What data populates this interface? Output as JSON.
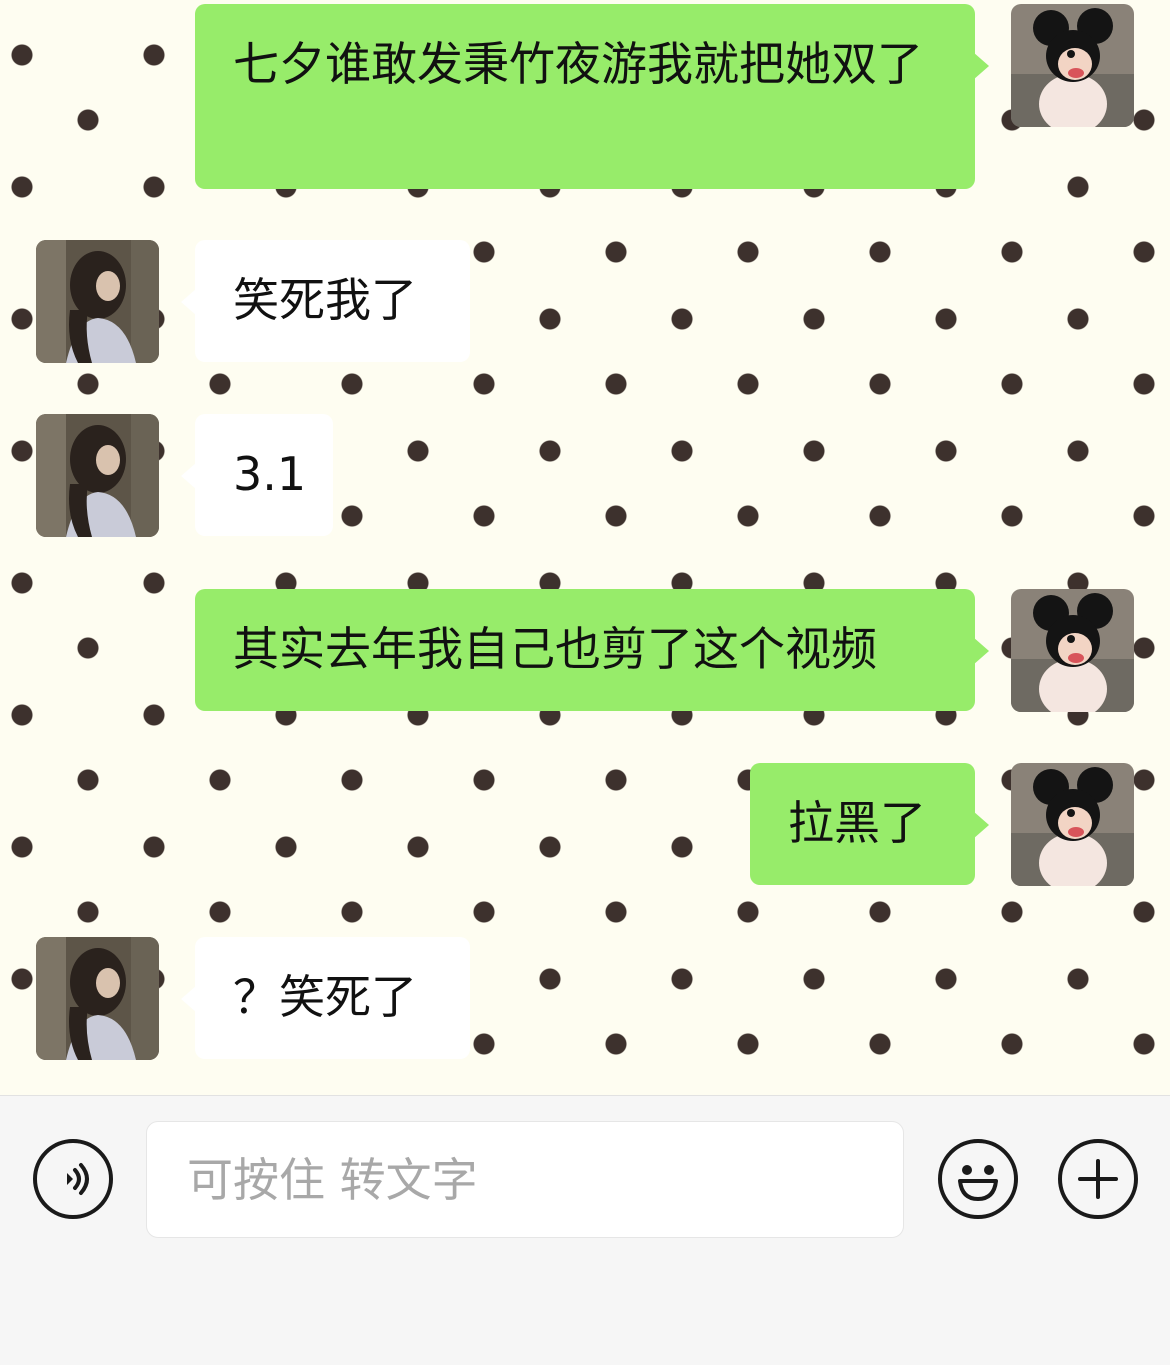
{
  "messages": [
    {
      "sender": "me",
      "text": "七夕谁敢发秉竹夜游我就把她双了"
    },
    {
      "sender": "other",
      "text": "笑死我了"
    },
    {
      "sender": "other",
      "text": "3.1"
    },
    {
      "sender": "me",
      "text": "其实去年我自己也剪了这个视频"
    },
    {
      "sender": "me",
      "text": "拉黑了"
    },
    {
      "sender": "other",
      "text": "？笑死了"
    }
  ],
  "avatars": {
    "me": "mickey-mask-avatar",
    "other": "long-hair-girl-avatar"
  },
  "input_bar": {
    "placeholder": "可按住 转文字",
    "voice_icon": "voice-icon",
    "emoji_icon": "emoji-icon",
    "plus_icon": "plus-icon"
  },
  "colors": {
    "my_bubble": "#97ec6a",
    "other_bubble": "#ffffff",
    "chat_background": "#fefdf1",
    "dots": "#3d312d"
  }
}
